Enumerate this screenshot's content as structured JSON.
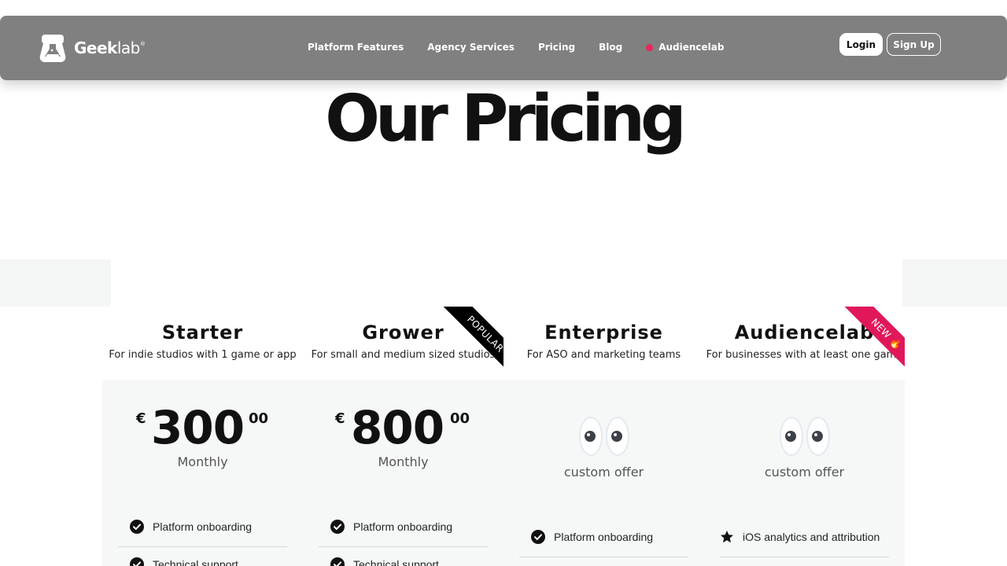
{
  "nav": {
    "brand_bold": "Geek",
    "brand_light": "lab",
    "brand_reg": "®",
    "items": [
      {
        "label": "Platform Features"
      },
      {
        "label": "Agency Services"
      },
      {
        "label": "Pricing"
      },
      {
        "label": "Blog"
      },
      {
        "label": "Audiencelab",
        "icon": "flame-icon",
        "icon_color": "#e8285a"
      }
    ],
    "login_label": "Login",
    "signup_label": "Sign Up"
  },
  "page": {
    "title": "Our Pricing"
  },
  "plans": [
    {
      "name": "Starter",
      "description": "For indie studios with 1 game or app",
      "currency": "€",
      "amount": "300",
      "cents": "00",
      "period": "Monthly",
      "features": [
        "Platform onboarding",
        "Technical support"
      ]
    },
    {
      "name": "Grower",
      "description": "For small and medium sized studios",
      "currency": "€",
      "amount": "800",
      "cents": "00",
      "period": "Monthly",
      "ribbon": "POPULAR",
      "ribbon_color": "#000000",
      "features": [
        "Platform onboarding",
        "Technical support"
      ]
    },
    {
      "name": "Enterprise",
      "description": "For ASO and marketing teams",
      "offer": "custom offer",
      "features": [
        "Platform onboarding"
      ]
    },
    {
      "name": "Audiencelab",
      "description": "For businesses with at least one game",
      "offer": "custom offer",
      "ribbon": "NEW",
      "ribbon_color": "#e0185a",
      "features": [
        "iOS analytics and attribution"
      ]
    }
  ],
  "colors": {
    "nav_bg": "#808080",
    "accent": "#e8285a",
    "panel_bg": "#f6f8f8"
  }
}
